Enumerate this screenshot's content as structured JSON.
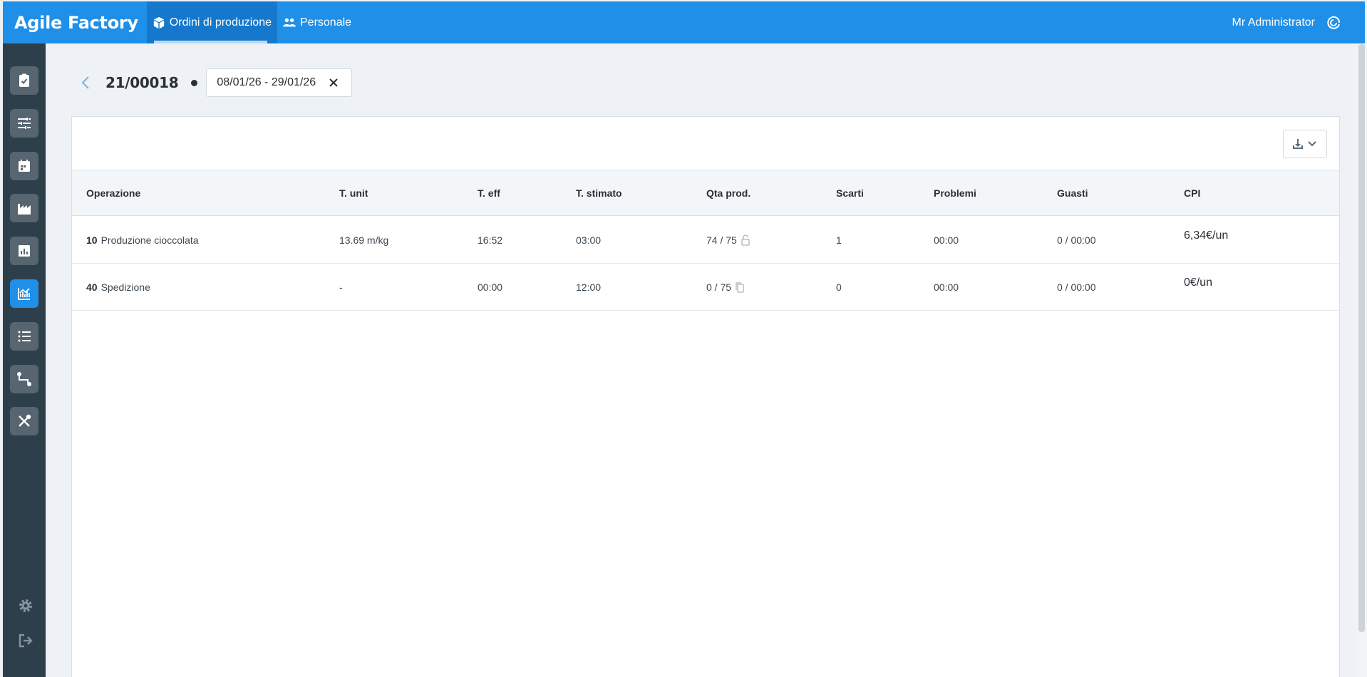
{
  "app": {
    "brand": "Agile Factory",
    "nav_tabs": [
      {
        "label": "Ordini di produzione",
        "icon": "box-icon",
        "active": true
      },
      {
        "label": "Personale",
        "icon": "people-icon",
        "active": false
      }
    ],
    "user_name": "Mr Administrator",
    "accent_color": "#1f8fe8"
  },
  "sidebar": {
    "items": [
      {
        "icon": "clipboard-check-icon",
        "active": false
      },
      {
        "icon": "sliders-icon",
        "active": false
      },
      {
        "icon": "calendar-icon",
        "active": false
      },
      {
        "icon": "factory-icon",
        "active": false
      },
      {
        "icon": "bar-chart-icon",
        "active": false
      },
      {
        "icon": "line-chart-icon",
        "active": true
      },
      {
        "icon": "list-icon",
        "active": false
      },
      {
        "icon": "route-icon",
        "active": false
      },
      {
        "icon": "tools-icon",
        "active": false
      }
    ],
    "bottom": [
      {
        "icon": "gear-icon"
      },
      {
        "icon": "logout-icon"
      }
    ]
  },
  "header": {
    "order_id": "21/00018",
    "date_range": "08/01/26 - 29/01/26"
  },
  "table": {
    "columns": [
      "Operazione",
      "T. unit",
      "T. eff",
      "T. stimato",
      "Qta prod.",
      "Scarti",
      "Problemi",
      "Guasti",
      "CPI"
    ],
    "rows": [
      {
        "op_num": "10",
        "op_name": "Produzione cioccolata",
        "t_unit": "13.69 m/kg",
        "t_eff": "16:52",
        "t_stimato": "03:00",
        "qta": "74 / 75",
        "qta_icon": "lock-open-icon",
        "scarti": "1",
        "problemi": "00:00",
        "guasti": "0 / 00:00",
        "cpi": "6,34€/un"
      },
      {
        "op_num": "40",
        "op_name": "Spedizione",
        "t_unit": "-",
        "t_eff": "00:00",
        "t_stimato": "12:00",
        "qta": "0 / 75",
        "qta_icon": "copy-icon",
        "scarti": "0",
        "problemi": "00:00",
        "guasti": "0 / 00:00",
        "cpi": "0€/un"
      }
    ]
  }
}
